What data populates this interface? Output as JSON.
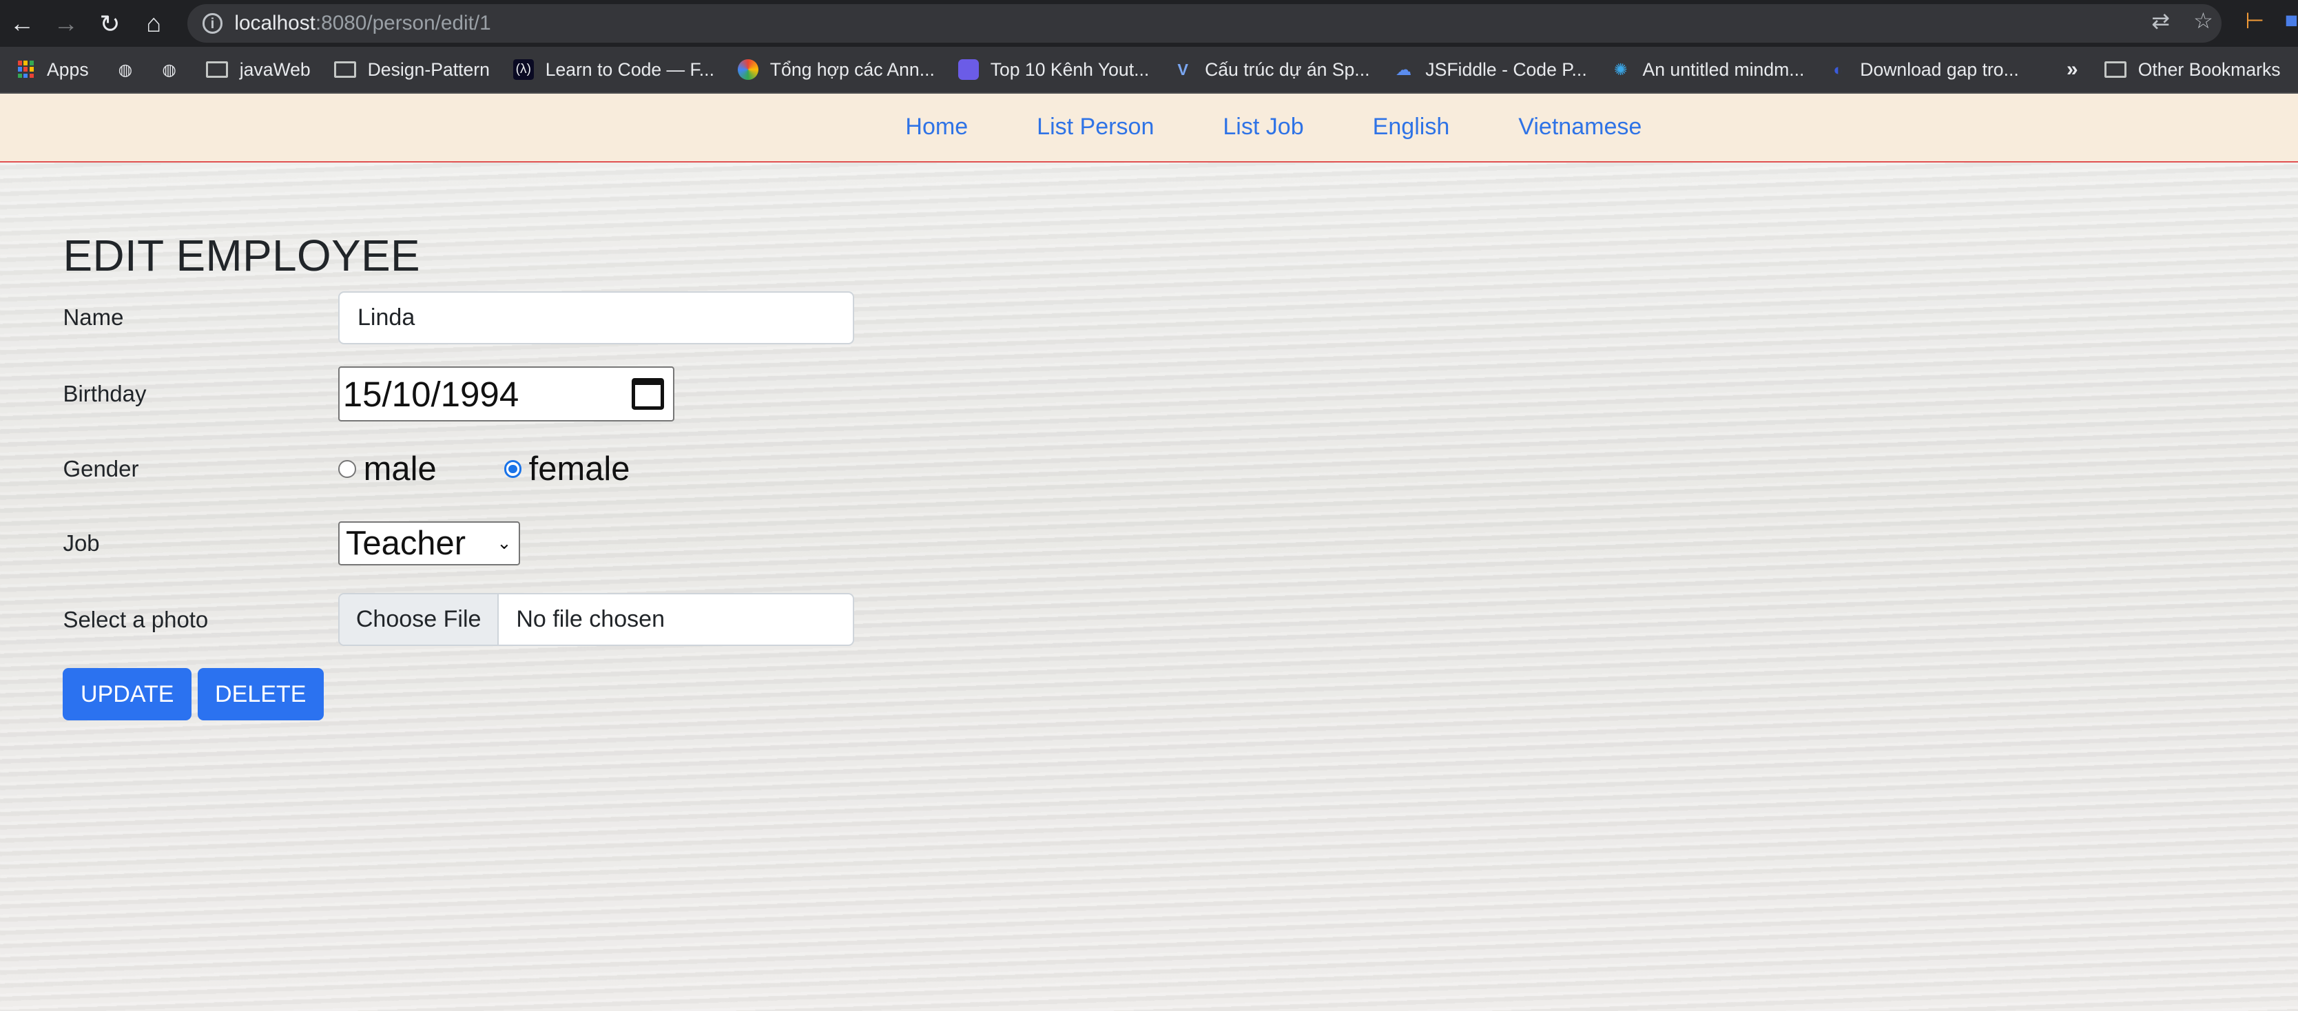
{
  "browser": {
    "url_host": "localhost",
    "url_rest": ":8080/person/edit/1"
  },
  "bookmarks": {
    "items": [
      {
        "label": "Apps",
        "icon": "apps-grid-icon"
      },
      {
        "label": "",
        "icon": "globe-icon"
      },
      {
        "label": "",
        "icon": "globe-icon"
      },
      {
        "label": "javaWeb",
        "icon": "folder-icon"
      },
      {
        "label": "Design-Pattern",
        "icon": "folder-icon"
      },
      {
        "label": "Learn to Code — F...",
        "icon": "freecodecamp-icon"
      },
      {
        "label": "Tổng hợp các Ann...",
        "icon": "colorful-circle-icon"
      },
      {
        "label": "Top 10 Kênh Yout...",
        "icon": "purple-square-icon"
      },
      {
        "label": "Cấu trúc dự án Sp...",
        "icon": "v-logo-icon"
      },
      {
        "label": "JSFiddle - Code P...",
        "icon": "cloud-icon"
      },
      {
        "label": "An untitled mindm...",
        "icon": "mindmap-icon"
      },
      {
        "label": "Download gap tro...",
        "icon": "blue-swirl-icon"
      }
    ],
    "overflow": "»",
    "other_bookmarks": "Other Bookmarks"
  },
  "navbar": {
    "links": [
      "Home",
      "List Person",
      "List Job",
      "English",
      "Vietnamese"
    ]
  },
  "form": {
    "title": "EDIT EMPLOYEE",
    "name_label": "Name",
    "name_value": "Linda",
    "birthday_label": "Birthday",
    "birthday_value": "15/10/1994",
    "gender_label": "Gender",
    "gender_options": [
      "male",
      "female"
    ],
    "gender_selected": "female",
    "job_label": "Job",
    "job_value": "Teacher",
    "photo_label": "Select a photo",
    "choose_file": "Choose File",
    "file_status": "No file chosen",
    "update_label": "UPDATE",
    "delete_label": "DELETE"
  },
  "colors": {
    "navbar_bg": "#f8ecdc",
    "navbar_border": "#e05252",
    "link": "#2f73e6",
    "button_primary": "#2b72f0"
  }
}
